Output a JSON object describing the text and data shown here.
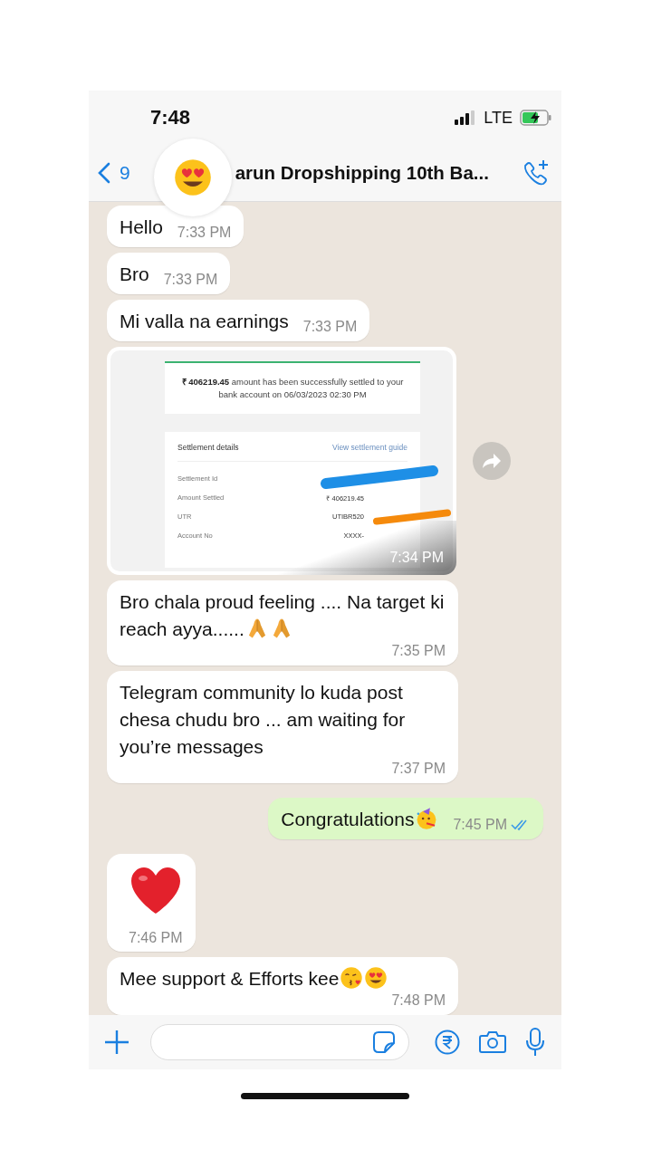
{
  "status_bar": {
    "time": "7:48",
    "network": "LTE",
    "charging": true
  },
  "header": {
    "back_count": "9",
    "title": "arun Dropshipping 10th Ba...",
    "avatar": {
      "kind": "heart-eyes"
    }
  },
  "messages": [
    {
      "kind": "text",
      "outgoing": false,
      "text": "Hello",
      "time": "7:33 PM"
    },
    {
      "kind": "text",
      "outgoing": false,
      "text": "Bro",
      "time": "7:33 PM"
    },
    {
      "kind": "text",
      "outgoing": false,
      "text": "Mi valla na earnings",
      "time": "7:33 PM"
    },
    {
      "kind": "image",
      "outgoing": false,
      "time": "7:34 PM",
      "attachment": {
        "notice": "**₹ 406219.45** amount has been successfully settled to your bank account on 06/03/2023 02:30 PM",
        "title": "Settlement details",
        "link": "View settlement guide",
        "rows": [
          {
            "label": "Settlement Id",
            "redaction": {
              "color": "#1e8fe6"
            }
          },
          {
            "label": "Amount Settled",
            "value": "₹ 406219.45"
          },
          {
            "label": "UTR",
            "value": "UTIBR520",
            "redaction": {
              "color": "#f58a0c"
            }
          },
          {
            "label": "Account No",
            "value": "XXXX-"
          }
        ]
      }
    },
    {
      "kind": "text",
      "outgoing": false,
      "text": "Bro chala proud feeling .... Na target ki reach ayya......",
      "emojis": [
        {
          "kind": "folded-hands"
        },
        {
          "kind": "folded-hands"
        }
      ],
      "time": "7:35 PM"
    },
    {
      "kind": "text",
      "outgoing": false,
      "text": "Telegram community lo kuda post chesa chudu bro ... am waiting for you’re messages",
      "time": "7:37 PM"
    },
    {
      "kind": "text",
      "outgoing": true,
      "text": "Congratulations",
      "emojis": [
        {
          "kind": "party-face"
        }
      ],
      "time": "7:45 PM",
      "read": true
    },
    {
      "kind": "heart",
      "outgoing": false,
      "time": "7:46 PM"
    },
    {
      "kind": "text",
      "outgoing": false,
      "text": "Mee support & Efforts kee",
      "emojis": [
        {
          "kind": "kiss-face"
        },
        {
          "kind": "heart-eyes"
        }
      ],
      "time": "7:48 PM"
    }
  ]
}
